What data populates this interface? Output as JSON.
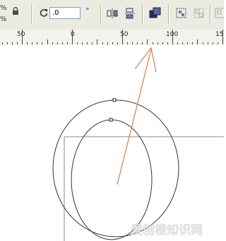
{
  "toolbar": {
    "percent_top": "%",
    "percent_bottom": "%",
    "lock_icon": "lock-icon",
    "rotate_icon": "rotate-icon",
    "angle_value": ".0",
    "degree_symbol": "°",
    "icons": [
      "mirror-horizontal-icon",
      "mirror-vertical-icon",
      "arrange-icon",
      "group-icon",
      "ungroup-icon",
      "ungroup-all-icon"
    ]
  },
  "ruler": {
    "labels": [
      "50",
      "0",
      "50",
      "100",
      "150"
    ]
  },
  "watermark": {
    "text": "爱刨根知识网"
  },
  "colors": {
    "toolbar_bg": "#ecebe2",
    "ruler_bg": "#f3f2eb",
    "arrow": "#d4885a",
    "shape_stroke": "#333333"
  }
}
